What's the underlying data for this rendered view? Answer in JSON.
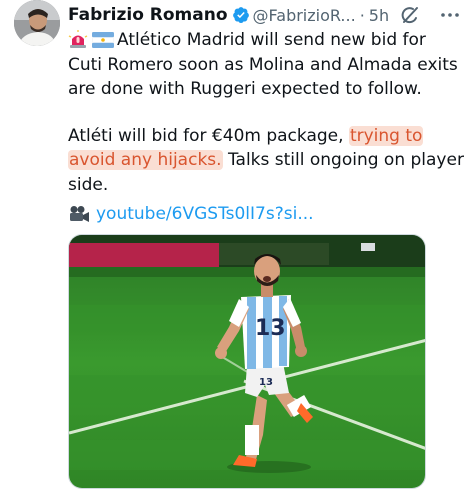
{
  "tweet": {
    "author_name": "Fabrizio Romano",
    "handle": "@FabrizioR...",
    "separator": "·",
    "time": "5h",
    "lines": [
      "Atlético Madrid will send new bid for",
      "Cuti Romero soon as Molina and Almada exits",
      "are done with Ruggeri expected to follow."
    ],
    "para2_line1_plain": "Atléti will bid for €40m package, ",
    "para2_line1_hl": "trying to",
    "para2_line2_hl": "avoid any hijacks.",
    "para2_line2_plain": " Talks still ongoing on player",
    "para2_line3": "side.",
    "link_text": "youtube/6VGSTs0lI7s?si..."
  },
  "icons": {
    "verified": "verified-badge-icon",
    "grok": "grok-icon",
    "more": "more-options-icon",
    "siren": "siren-emoji-icon",
    "flag": "argentina-flag-icon",
    "camera": "video-camera-emoji-icon"
  },
  "colors": {
    "text": "#0f1419",
    "secondary": "#536471",
    "link": "#1d9bf0",
    "verified": "#1d9bf0",
    "highlight": "#d9552f"
  },
  "image": {
    "jersey_number": "13"
  }
}
